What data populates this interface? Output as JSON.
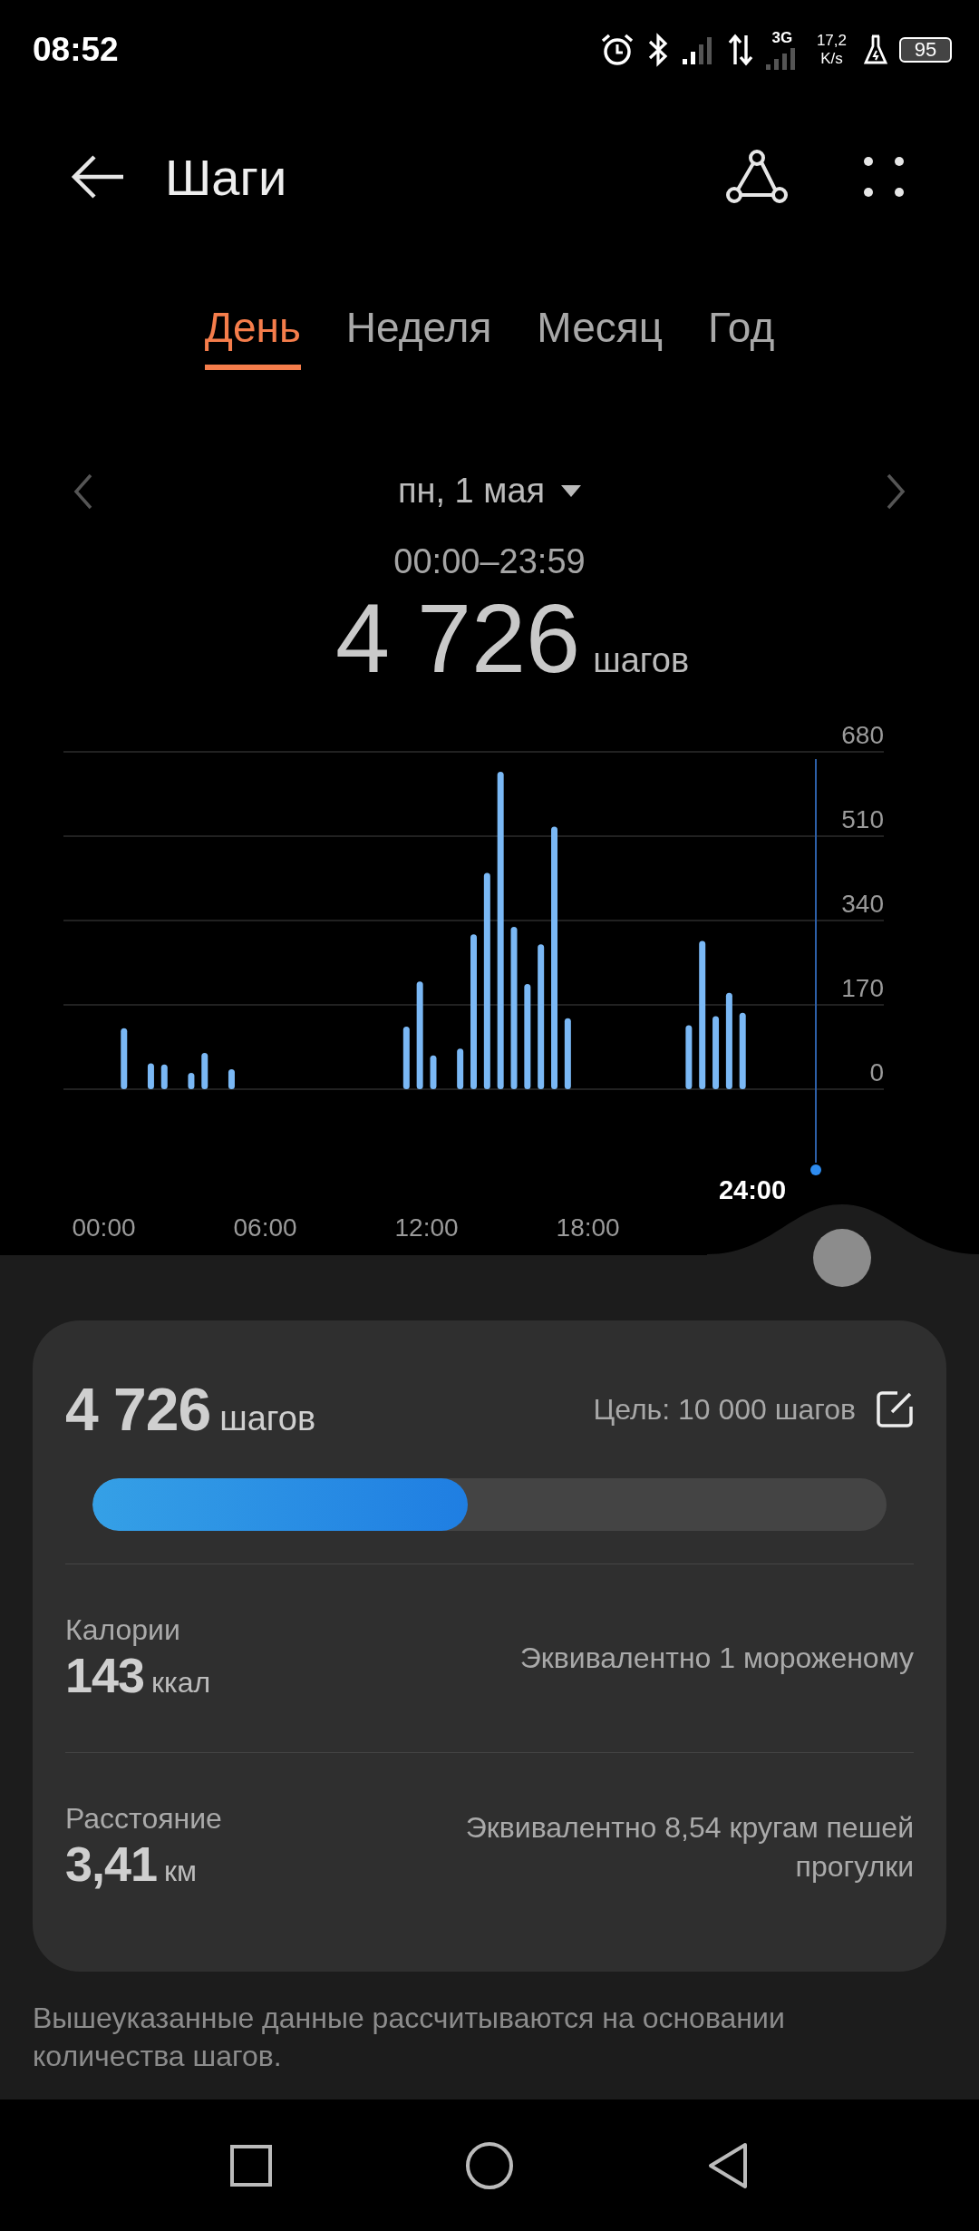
{
  "status_bar": {
    "time": "08:52",
    "network_type": "3G",
    "speed": "17,2",
    "speed_unit": "K/s",
    "battery": "95"
  },
  "header": {
    "title": "Шаги"
  },
  "tabs": [
    {
      "label": "День",
      "selected": true
    },
    {
      "label": "Неделя",
      "selected": false
    },
    {
      "label": "Месяц",
      "selected": false
    },
    {
      "label": "Год",
      "selected": false
    }
  ],
  "date_nav": {
    "date": "пн, 1 мая",
    "time_range": "00:00–23:59"
  },
  "total": {
    "value": "4 726",
    "unit": "шагов"
  },
  "chart": {
    "cursor_label": "24:00",
    "chart_data": {
      "type": "bar",
      "grid": true,
      "x": [
        0.75,
        1.75,
        2.25,
        3.25,
        3.75,
        4.75,
        11.25,
        11.75,
        12.25,
        13.25,
        13.75,
        14.25,
        14.75,
        15.25,
        15.75,
        16.25,
        16.75,
        17.25,
        21.75,
        22.25,
        22.75,
        23.25,
        23.75
      ],
      "values": [
        123,
        52,
        50,
        33,
        73,
        40,
        126,
        217,
        68,
        82,
        312,
        436,
        640,
        327,
        212,
        292,
        529,
        143,
        129,
        299,
        147,
        194,
        154
      ],
      "xlim": [
        -1.5,
        29
      ],
      "ylim": [
        0,
        680
      ],
      "xticks": [
        {
          "value": 0,
          "label": "00:00"
        },
        {
          "value": 6,
          "label": "06:00"
        },
        {
          "value": 12,
          "label": "12:00"
        },
        {
          "value": 18,
          "label": "18:00"
        }
      ],
      "yticks": [
        0,
        170,
        340,
        510,
        680
      ]
    }
  },
  "summary": {
    "steps": {
      "value": "4 726",
      "unit": "шагов"
    },
    "goal": "Цель: 10 000 шагов",
    "level": 0.4726,
    "metrics": [
      {
        "label": "Калории",
        "value": "143",
        "unit": "ккал",
        "equivalent": "Эквивалентно 1 мороженому"
      },
      {
        "label": "Расстояние",
        "value": "3,41",
        "unit": "км",
        "equivalent": "Эквивалентно 8,54 кругам пешей прогулки"
      }
    ]
  },
  "footnote": "Вышеуказанные данные рассчитываются на основании количества шагов."
}
